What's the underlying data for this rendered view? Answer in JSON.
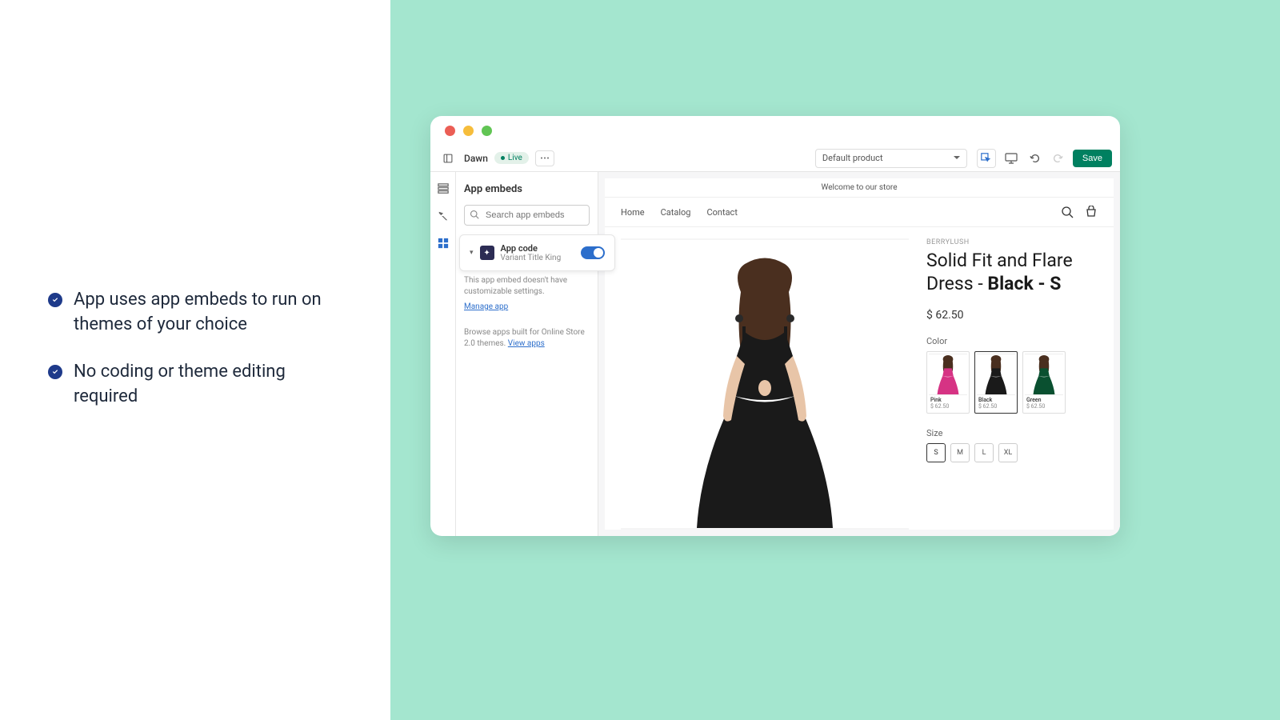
{
  "features": [
    "App uses app embeds to run on themes of your choice",
    "No coding or theme editing required"
  ],
  "toolbar": {
    "theme_name": "Dawn",
    "live_label": "Live",
    "product_selector": "Default product",
    "save_label": "Save"
  },
  "sidebar": {
    "title": "App embeds",
    "search_placeholder": "Search app embeds",
    "app_embed": {
      "title": "App code",
      "subtitle": "Variant Title King",
      "enabled": true
    },
    "embed_desc": "This app embed doesn't have customizable settings.",
    "manage_link": "Manage app",
    "browse_desc": "Browse apps built for Online Store 2.0 themes. ",
    "view_apps_link": "View apps"
  },
  "store": {
    "announcement": "Welcome to our store",
    "nav": [
      "Home",
      "Catalog",
      "Contact"
    ],
    "product": {
      "brand": "BERRYLUSH",
      "title_base": "Solid Fit and Flare Dress - ",
      "title_variant": "Black - S",
      "price": "$ 62.50",
      "color_label": "Color",
      "colors": [
        {
          "name": "Pink",
          "price": "$ 62.50",
          "hex": "#d63384"
        },
        {
          "name": "Black",
          "price": "$ 62.50",
          "hex": "#1a1a1a"
        },
        {
          "name": "Green",
          "price": "$ 62.50",
          "hex": "#0a5030"
        }
      ],
      "selected_color": 1,
      "size_label": "Size",
      "sizes": [
        "S",
        "M",
        "L",
        "XL"
      ],
      "selected_size": 0
    }
  }
}
